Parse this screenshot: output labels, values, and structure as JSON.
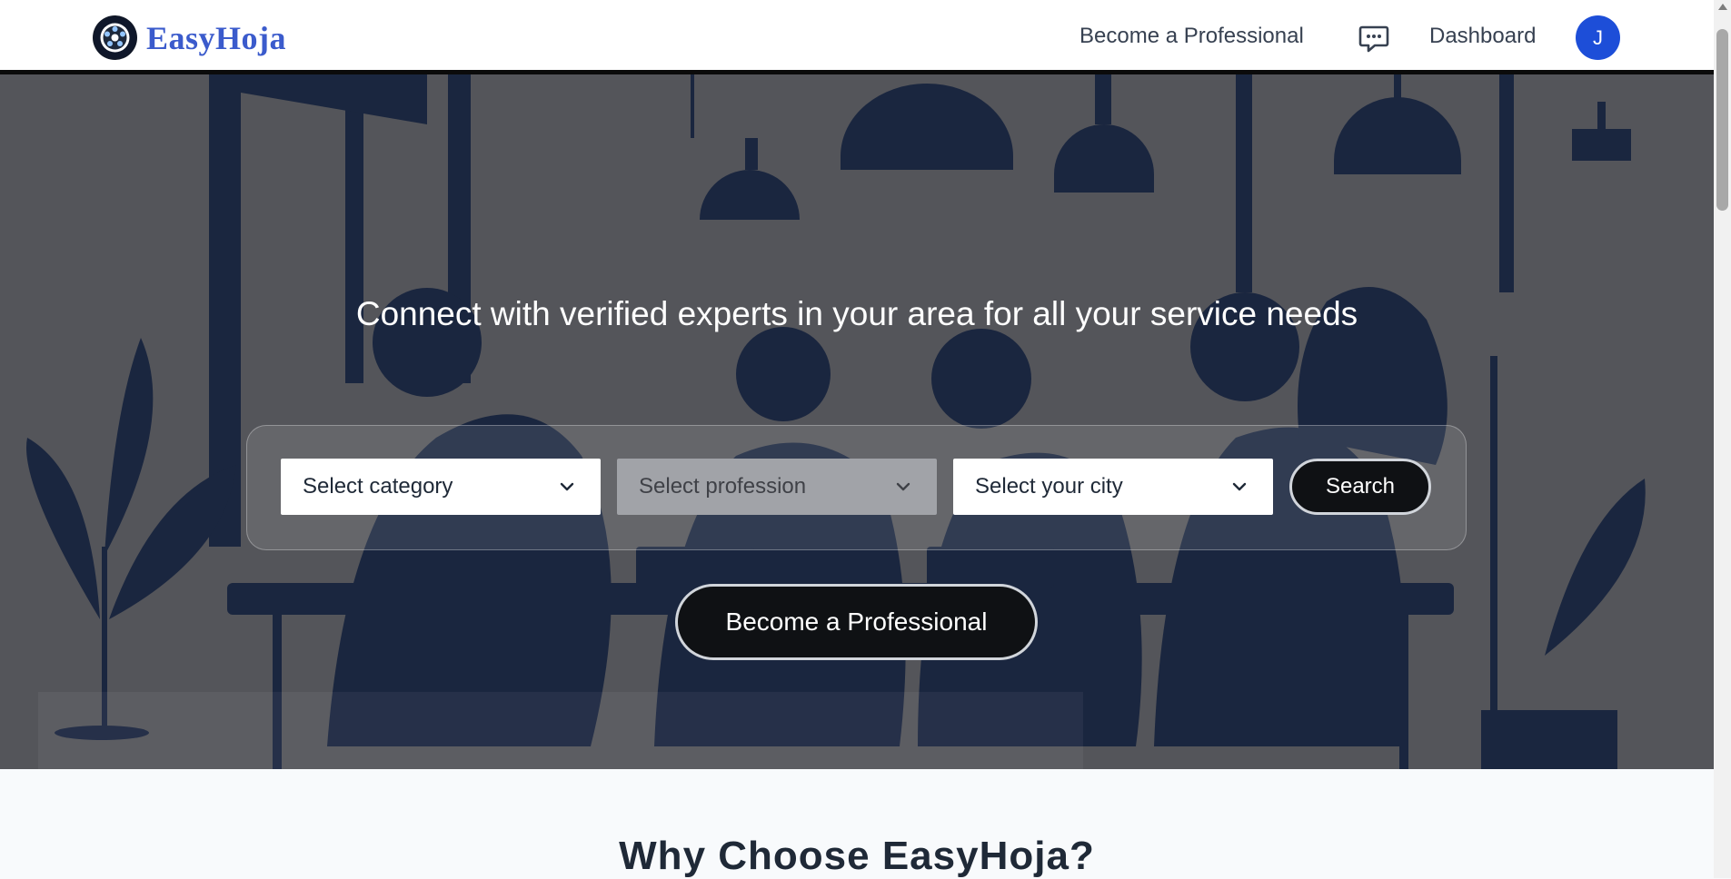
{
  "header": {
    "brand": "EasyHoja",
    "nav_become": "Become a Professional",
    "chat_icon": "chat-icon",
    "nav_dashboard": "Dashboard",
    "avatar_initial": "J"
  },
  "hero": {
    "title": "Connect with verified experts in your area for all your service needs",
    "category_placeholder": "Select category",
    "profession_placeholder": "Select profession",
    "city_placeholder": "Select your city",
    "search_label": "Search",
    "become_label": "Become a Professional"
  },
  "section": {
    "why_title": "Why Choose EasyHoja?"
  },
  "colors": {
    "brand": "#3b5bcc",
    "avatar": "#1d4ed8",
    "button_dark": "#0f1114",
    "illustration": "#14223f"
  }
}
